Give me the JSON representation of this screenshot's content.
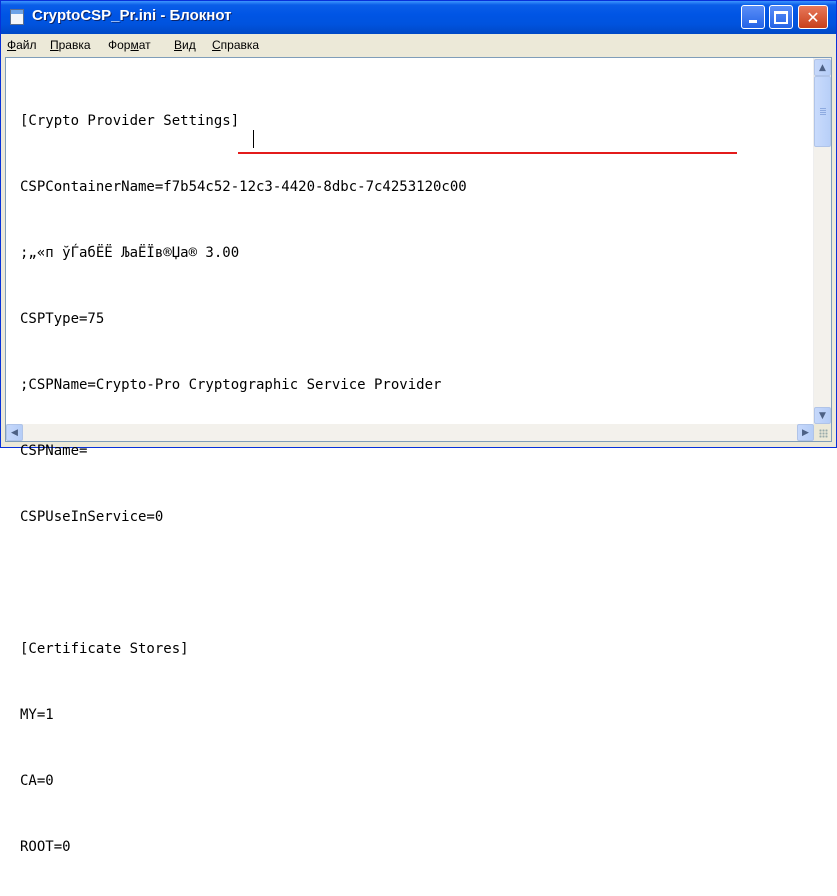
{
  "window": {
    "title": "CryptoCSP_Pr.ini - Блокнот",
    "controls": [
      "minimize-icon",
      "maximize-icon",
      "close-icon"
    ]
  },
  "menu": {
    "items": [
      {
        "label": "Файл"
      },
      {
        "label": "Правка"
      },
      {
        "label": "Формат"
      },
      {
        "label": "Вид"
      },
      {
        "label": "Справка"
      }
    ]
  },
  "editor": {
    "lines": [
      "[Crypto Provider Settings]",
      "CSPContainerName=f7b54c52-12c3-4420-8dbc-7c4253120c00",
      ";„«п ўЃабЁЁ ЉаЁЇв®Џа® 3.00",
      "CSPType=75",
      ";CSPName=Crypto-Pro Cryptographic Service Provider",
      "CSPName=",
      "CSPUseInService=0",
      "",
      "[Certificate Stores]",
      "MY=1",
      "CA=0",
      "ROOT=0"
    ],
    "annotation_color": "#e31b1b"
  },
  "colors": {
    "titlebar": "#0055e5",
    "close_button": "#c8401c",
    "chrome": "#ece9d8"
  }
}
